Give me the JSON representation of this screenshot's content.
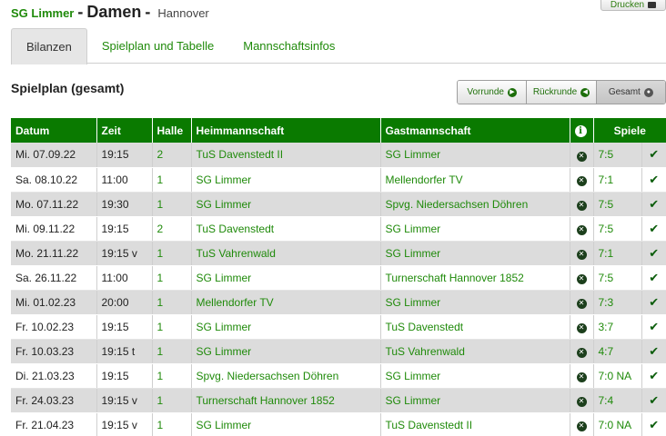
{
  "header": {
    "print_label": "Drucken",
    "club": "SG Limmer",
    "separator": "-",
    "team": "Damen",
    "separator2": "-",
    "city": "Hannover"
  },
  "tabs": [
    {
      "label": "Bilanzen",
      "active": true
    },
    {
      "label": "Spielplan und Tabelle",
      "active": false
    },
    {
      "label": "Mannschaftsinfos",
      "active": false
    }
  ],
  "section_title": "Spielplan (gesamt)",
  "filters": [
    {
      "label": "Vorrunde",
      "icon": "arrow-right-circle-icon",
      "glyph": "▶",
      "active": false
    },
    {
      "label": "Rückrunde",
      "icon": "arrow-left-circle-icon",
      "glyph": "◀",
      "active": false
    },
    {
      "label": "Gesamt",
      "icon": "dot-circle-icon",
      "glyph": "●",
      "active": true
    }
  ],
  "colors": {
    "accent": "#0a7a00",
    "link": "#1f8a0a",
    "row_alt": "#dcdcdc"
  },
  "table": {
    "headers": {
      "datum": "Datum",
      "zeit": "Zeit",
      "halle": "Halle",
      "heim": "Heimmannschaft",
      "gast": "Gastmannschaft",
      "info": "i",
      "spiele": "Spiele"
    },
    "rows": [
      {
        "datum": "Mi. 07.09.22",
        "zeit": "19:15",
        "halle": "2",
        "heim": "TuS Davenstedt II",
        "gast": "SG Limmer",
        "ergebnis": "7:5"
      },
      {
        "datum": "Sa. 08.10.22",
        "zeit": "11:00",
        "halle": "1",
        "heim": "SG Limmer",
        "gast": "Mellendorfer TV",
        "ergebnis": "7:1"
      },
      {
        "datum": "Mo. 07.11.22",
        "zeit": "19:30",
        "halle": "1",
        "heim": "SG Limmer",
        "gast": "Spvg. Niedersachsen Döhren",
        "ergebnis": "7:5"
      },
      {
        "datum": "Mi. 09.11.22",
        "zeit": "19:15",
        "halle": "2",
        "heim": "TuS Davenstedt",
        "gast": "SG Limmer",
        "ergebnis": "7:5"
      },
      {
        "datum": "Mo. 21.11.22",
        "zeit": "19:15 v",
        "halle": "1",
        "heim": "TuS Vahrenwald",
        "gast": "SG Limmer",
        "ergebnis": "7:1"
      },
      {
        "datum": "Sa. 26.11.22",
        "zeit": "11:00",
        "halle": "1",
        "heim": "SG Limmer",
        "gast": "Turnerschaft Hannover 1852",
        "ergebnis": "7:5"
      },
      {
        "datum": "Mi. 01.02.23",
        "zeit": "20:00",
        "halle": "1",
        "heim": "Mellendorfer TV",
        "gast": "SG Limmer",
        "ergebnis": "7:3"
      },
      {
        "datum": "Fr. 10.02.23",
        "zeit": "19:15",
        "halle": "1",
        "heim": "SG Limmer",
        "gast": "TuS Davenstedt",
        "ergebnis": "3:7"
      },
      {
        "datum": "Fr. 10.03.23",
        "zeit": "19:15 t",
        "halle": "1",
        "heim": "SG Limmer",
        "gast": "TuS Vahrenwald",
        "ergebnis": "4:7"
      },
      {
        "datum": "Di. 21.03.23",
        "zeit": "19:15",
        "halle": "1",
        "heim": "Spvg. Niedersachsen Döhren",
        "gast": "SG Limmer",
        "ergebnis": "7:0 NA"
      },
      {
        "datum": "Fr. 24.03.23",
        "zeit": "19:15 v",
        "halle": "1",
        "heim": "Turnerschaft Hannover 1852",
        "gast": "SG Limmer",
        "ergebnis": "7:4"
      },
      {
        "datum": "Fr. 21.04.23",
        "zeit": "19:15 v",
        "halle": "1",
        "heim": "SG Limmer",
        "gast": "TuS Davenstedt II",
        "ergebnis": "7:0 NA"
      }
    ]
  }
}
